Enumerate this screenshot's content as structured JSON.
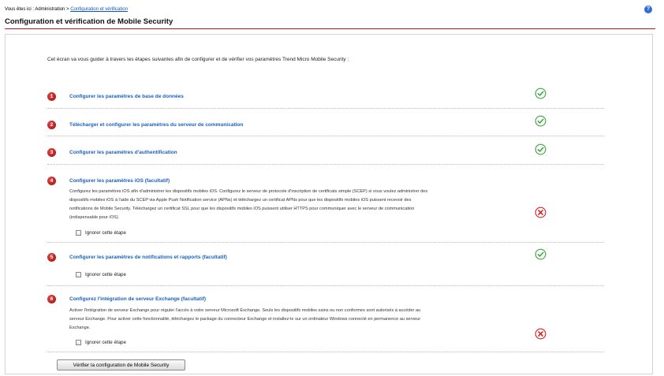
{
  "breadcrumb": {
    "prefix": "Vous êtes ici : Administration > ",
    "current": "Configuration et vérification"
  },
  "help_icon": "question-icon",
  "page_title": "Configuration et vérification de Mobile Security",
  "intro": "Cet écran va vous guider à travers les étapes suivantes afin de configurer et de vérifier vos paramètres Trend Micro Mobile Security :",
  "skip_label": "Ignorer cette étape",
  "steps": [
    {
      "num": "1",
      "title": "Configurer les paramètres de base de données",
      "status": "ok"
    },
    {
      "num": "2",
      "title": "Télécharger et configurer les paramètres du serveur de communication",
      "status": "ok"
    },
    {
      "num": "3",
      "title": "Configurer les paramètres d'authentification",
      "status": "ok"
    },
    {
      "num": "4",
      "title": "Configurer les paramètres iOS (facultatif)",
      "status": "error",
      "lines": [
        "Configurez les paramètres iOS afin d'administrer les dispositifs mobiles iOS. Configurez le serveur de protocole d'inscription de certificats simple (SCEP) si vous voulez administrer des",
        "dispositifs mobiles iOS à l'aide du SCEP via Apple Push Notification service (APNs) et téléchargez un certificat APNs pour que les dispositifs mobiles iOS puissent recevoir des",
        "notifications de Mobile Security. Téléchargez un certificat SSL pour que les dispositifs mobiles iOS puissent utiliser HTTPS pour communiquer avec le serveur de communication",
        "(indispensable pour iOS)."
      ]
    },
    {
      "num": "5",
      "title": "Configurer les paramètres de notifications et rapports (facultatif)",
      "status": "ok"
    },
    {
      "num": "6",
      "title": "Configurez l'intégration de serveur Exchange (facultatif)",
      "status": "error",
      "lines": [
        "Activer l'intégration de serveur Exchange pour réguler l'accès à votre serveur Microsoft Exchange. Seuls les dispositifs mobiles sains ou non conformes sont autorisés à accéder au",
        "serveur Exchange. Pour activer cette fonctionnalité, téléchargez le package du connecteur Exchange et installez-le sur un ordinateur Windows connecté en permanence au serveur",
        "Exchange."
      ]
    }
  ],
  "verify_button": "Vérifier la configuration de Mobile Security",
  "colors": {
    "accent_red": "#b81c1c",
    "link_blue": "#1a5fc4",
    "ok_green": "#3aa63a",
    "error_red": "#d32323"
  }
}
